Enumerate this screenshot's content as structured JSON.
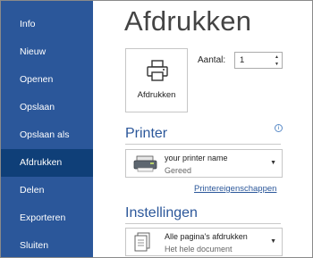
{
  "sidebar": {
    "items": [
      {
        "label": "Info"
      },
      {
        "label": "Nieuw"
      },
      {
        "label": "Openen"
      },
      {
        "label": "Opslaan"
      },
      {
        "label": "Opslaan als"
      },
      {
        "label": "Afdrukken",
        "active": true
      },
      {
        "label": "Delen"
      },
      {
        "label": "Exporteren"
      },
      {
        "label": "Sluiten"
      }
    ]
  },
  "main": {
    "title": "Afdrukken",
    "print_button_label": "Afdrukken",
    "copies": {
      "label": "Aantal:",
      "value": "1"
    },
    "printer": {
      "heading": "Printer",
      "info_glyph": "i",
      "name": "your printer name",
      "status": "Gereed",
      "properties_link": "Printereigenschappen"
    },
    "settings": {
      "heading": "Instellingen",
      "pages_option": "Alle pagina's afdrukken",
      "pages_description": "Het hele document"
    }
  },
  "colors": {
    "sidebar_bg": "#2b579a",
    "sidebar_active": "#0f3f78",
    "accent": "#2b579a"
  },
  "icons": [
    "printer-icon",
    "printer-device-icon",
    "document-pages-icon",
    "info-icon",
    "caret-down-icon",
    "spin-up-icon",
    "spin-down-icon"
  ]
}
